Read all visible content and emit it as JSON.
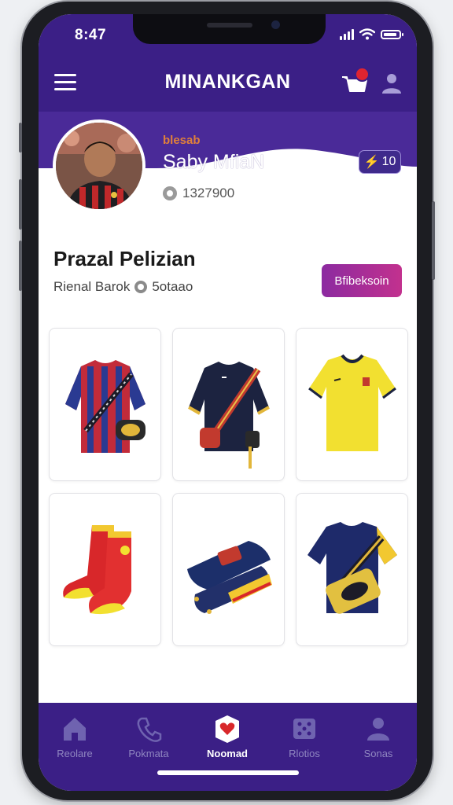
{
  "status_bar": {
    "time": "8:47"
  },
  "header": {
    "title": "MINANKGAN"
  },
  "profile": {
    "tag": "blesab",
    "name": "Saby MfiaN",
    "points": "1327900",
    "level": "10"
  },
  "section": {
    "title": "Prazal Pelizian",
    "meta_left": "Rienal Barok",
    "meta_right": "5otaao",
    "action_label": "Bfibeksoin"
  },
  "products": [
    {
      "name": "striped-red-blue-jersey"
    },
    {
      "name": "navy-jersey-with-sash"
    },
    {
      "name": "yellow-jersey"
    },
    {
      "name": "red-yellow-boots"
    },
    {
      "name": "folded-kit-with-boots"
    },
    {
      "name": "navy-jersey-with-bag"
    }
  ],
  "bottom_nav": [
    {
      "label": "Reolare",
      "icon": "home-icon",
      "active": false
    },
    {
      "label": "Pokmata",
      "icon": "phone-icon",
      "active": false
    },
    {
      "label": "Noomad",
      "icon": "heart-icon",
      "active": true
    },
    {
      "label": "Rlotios",
      "icon": "dice-icon",
      "active": false
    },
    {
      "label": "Sonas",
      "icon": "user-icon",
      "active": false
    }
  ],
  "colors": {
    "primary": "#3b1f86",
    "accent": "#c2318e",
    "badge": "#e02430"
  }
}
